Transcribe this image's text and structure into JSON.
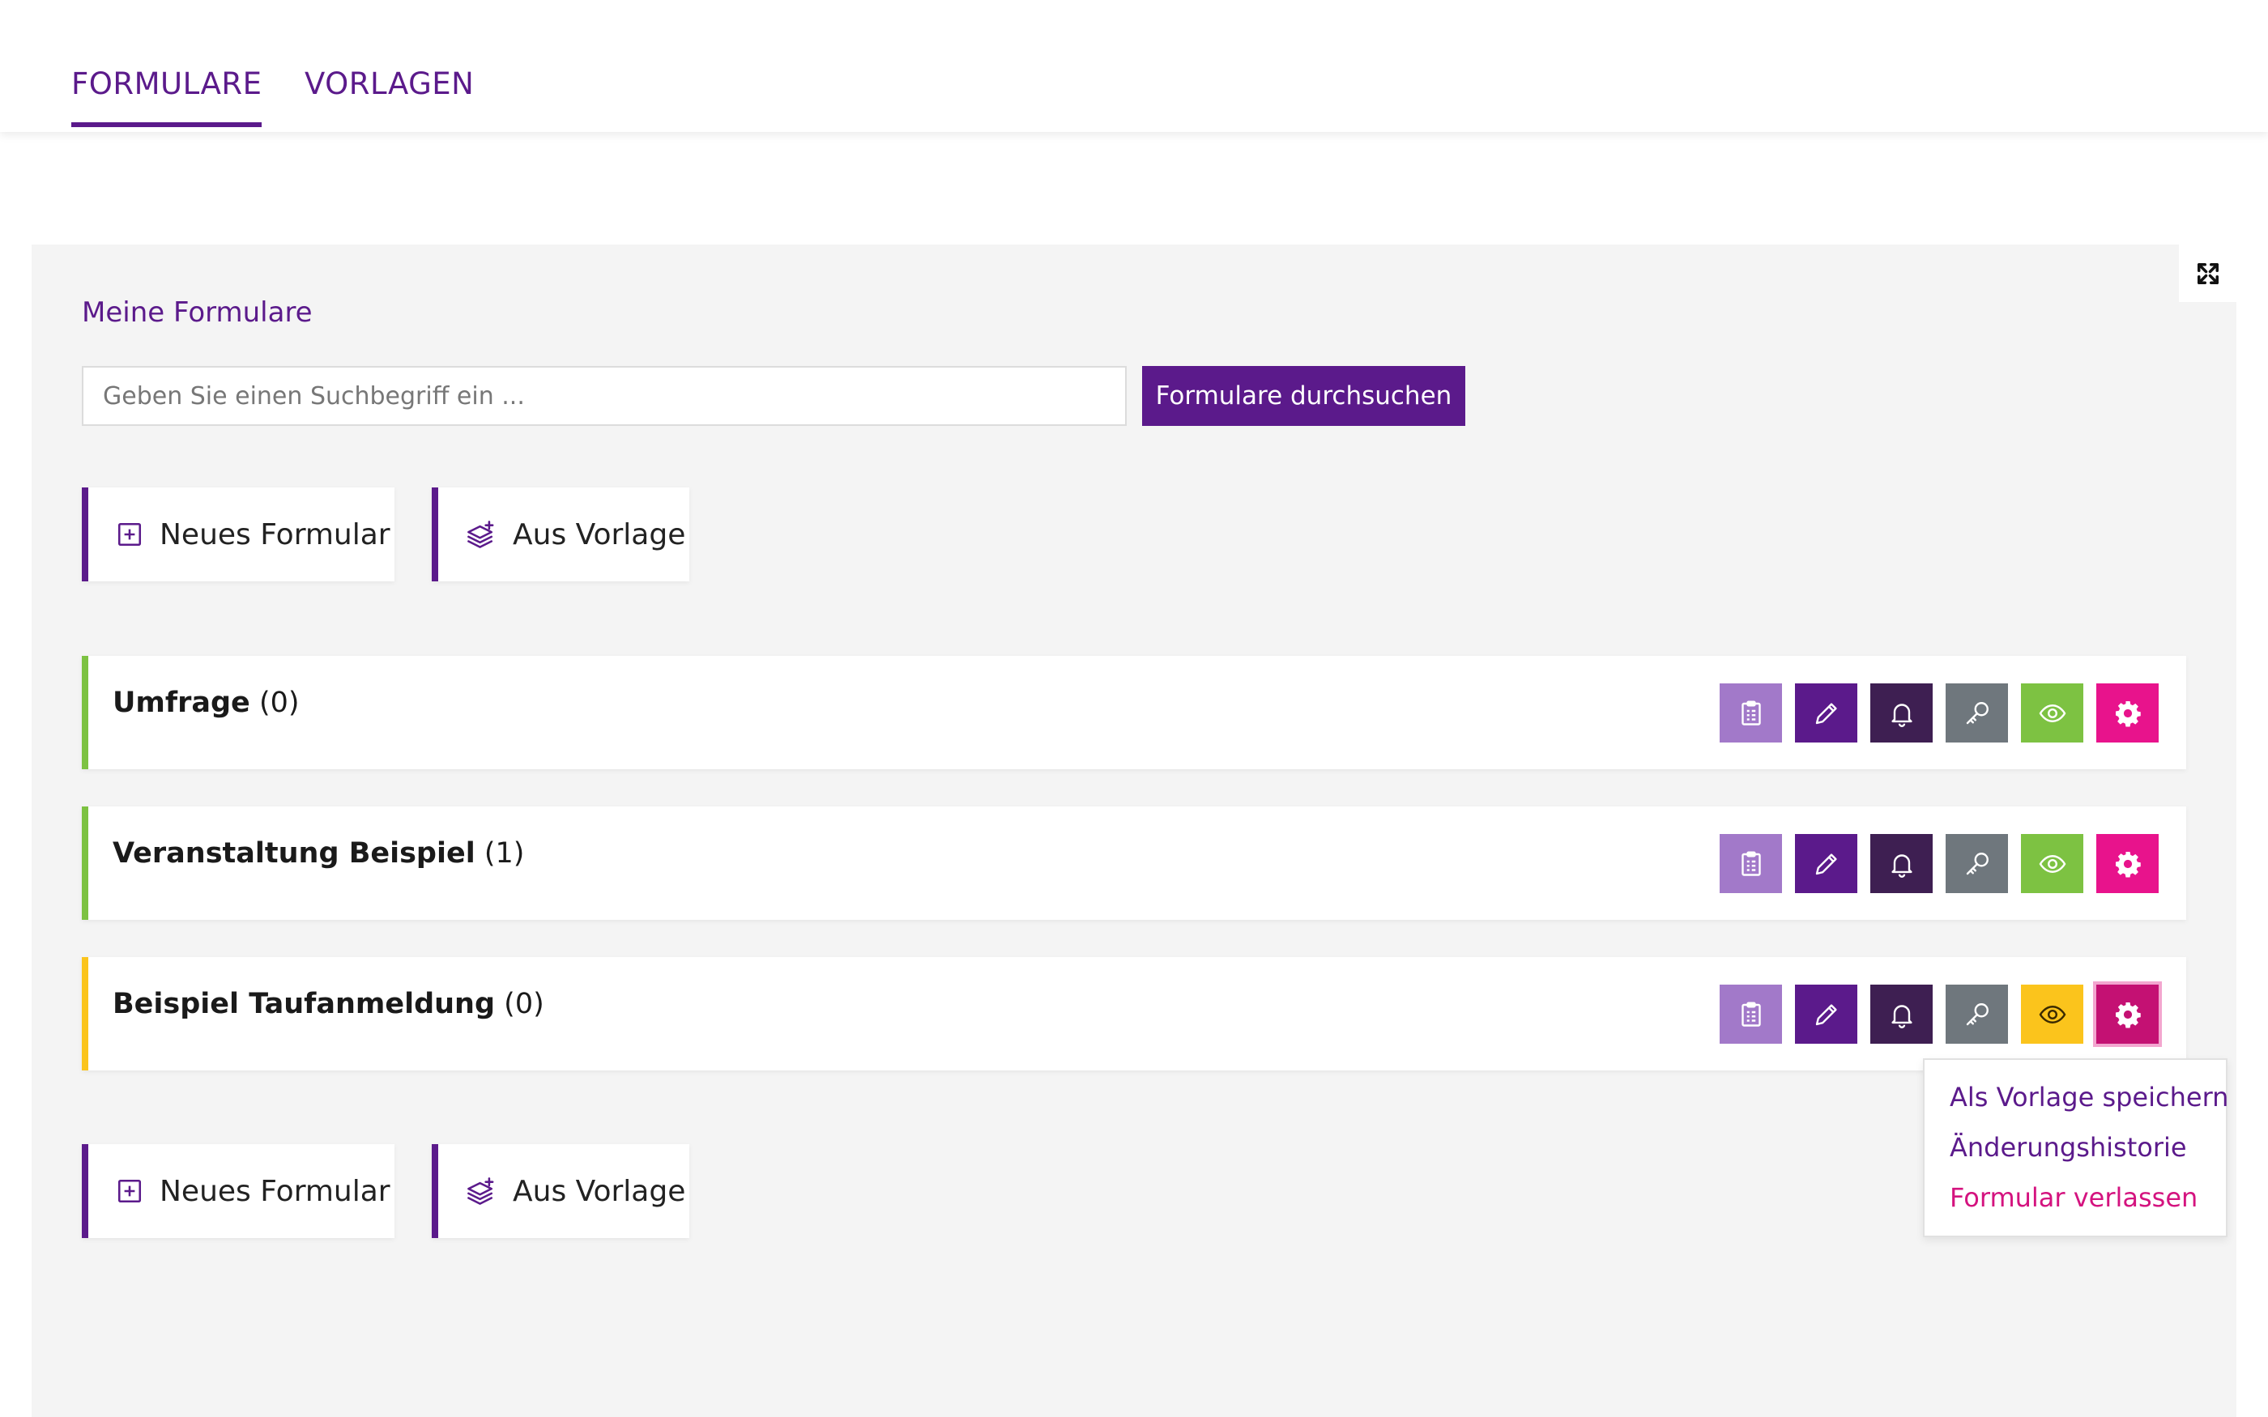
{
  "tabs": [
    {
      "label": "FORMULARE",
      "active": true
    },
    {
      "label": "VORLAGEN",
      "active": false
    }
  ],
  "section": {
    "title": "Meine Formulare"
  },
  "search": {
    "placeholder": "Geben Sie einen Suchbegriff ein ...",
    "value": "",
    "button_label": "Formulare durchsuchen"
  },
  "actions": {
    "new_form": "Neues Formular",
    "from_template": "Aus Vorlage"
  },
  "forms": [
    {
      "name": "Umfrage",
      "count": "(0)",
      "status_color": "#7dc242",
      "visibility_color": "#7dc242"
    },
    {
      "name": "Veranstaltung Beispiel",
      "count": "(1)",
      "status_color": "#7dc242",
      "visibility_color": "#7dc242"
    },
    {
      "name": "Beispiel Taufanmeldung",
      "count": "(0)",
      "status_color": "#fbc41c",
      "visibility_color": "#fbc41c"
    }
  ],
  "row_icons": [
    "clipboard-icon",
    "pencil-icon",
    "bell-icon",
    "key-icon",
    "eye-icon",
    "gear-icon"
  ],
  "colors": {
    "primary": "#5b1a8b",
    "clipboard": "#a279c9",
    "bell": "#3e1f52",
    "key": "#6f777d",
    "settings": "#e8138c",
    "settings_active": "#c41173",
    "danger_text": "#d4137f"
  },
  "dropdown": {
    "items": [
      "Als Vorlage speichern",
      "Änderungshistorie",
      "Formular verlassen"
    ]
  }
}
